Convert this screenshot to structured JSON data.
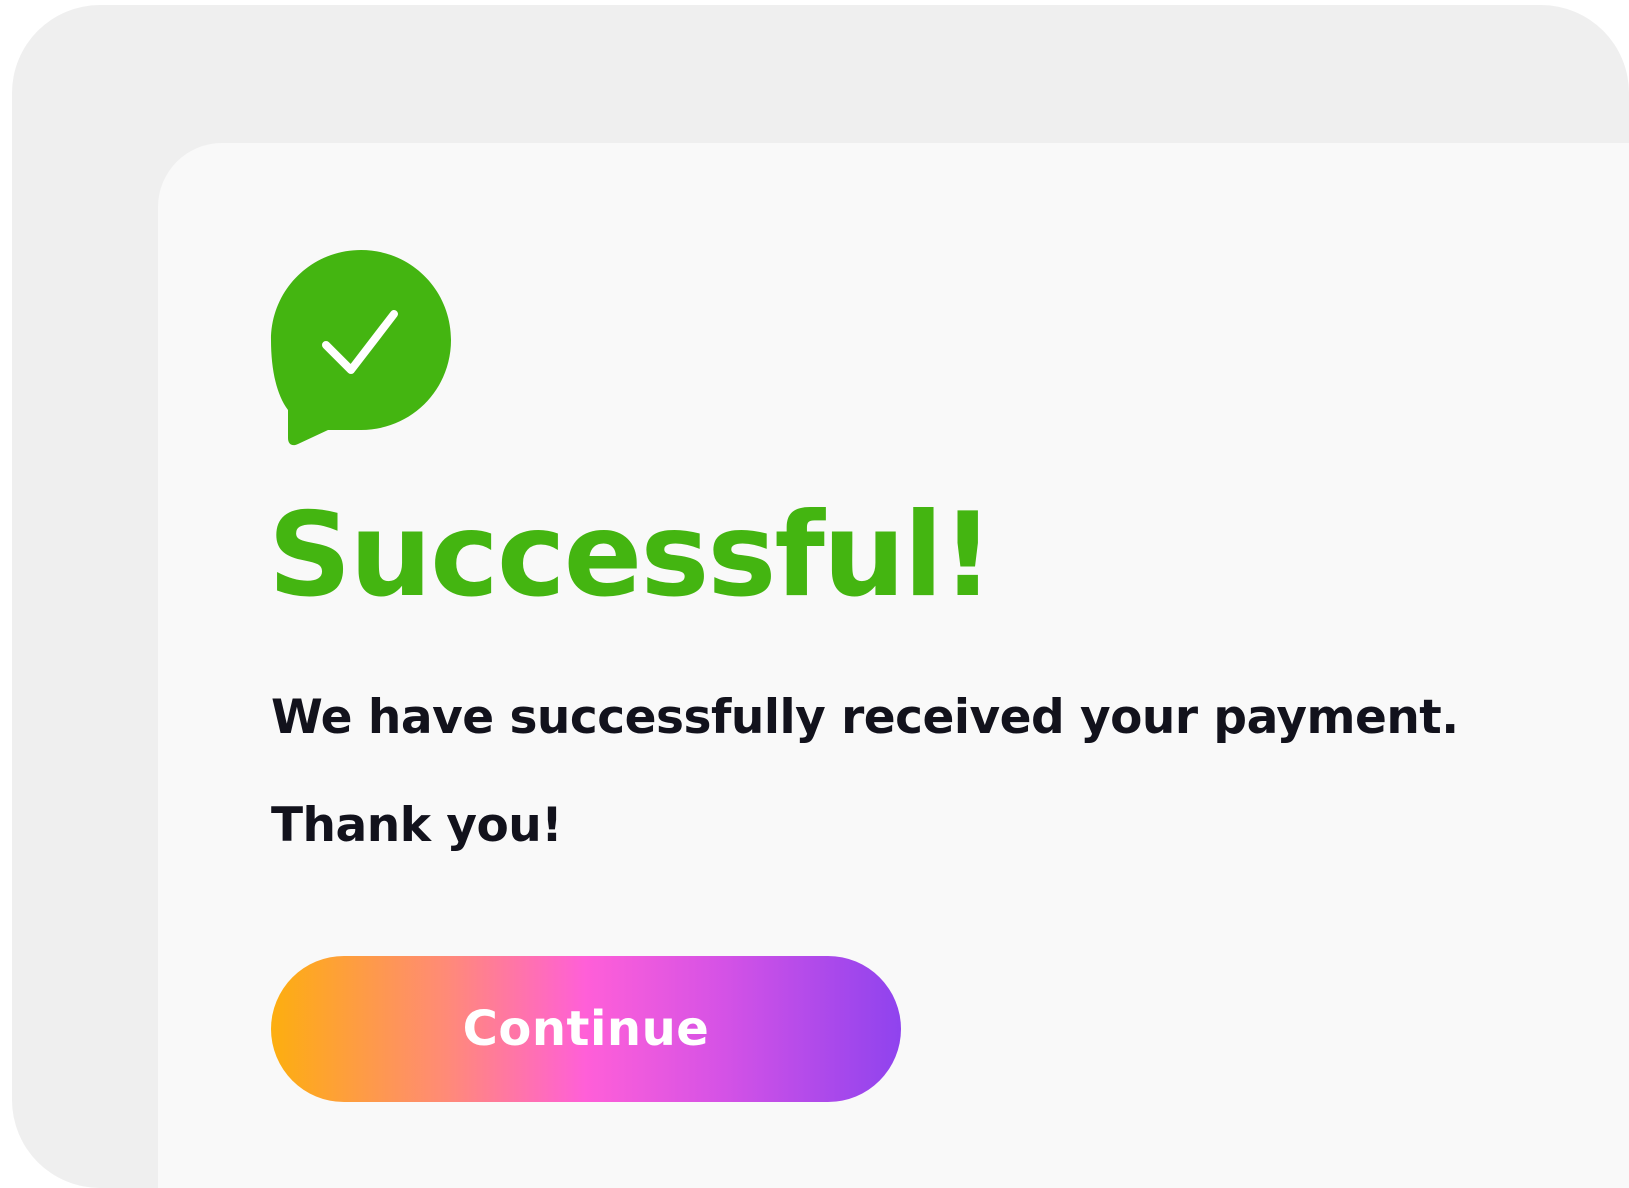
{
  "colors": {
    "success_green": "#44b511",
    "text_dark": "#12121c",
    "button_gradient": [
      "#fdae0f",
      "#ff8a78",
      "#ff5fd8",
      "#d452e6",
      "#8f43ee"
    ]
  },
  "icon": {
    "name": "chat-bubble-check-icon"
  },
  "title": "Successful!",
  "message": "We have successfully received your payment.",
  "thanks": "Thank you!",
  "button": {
    "label": "Continue"
  }
}
